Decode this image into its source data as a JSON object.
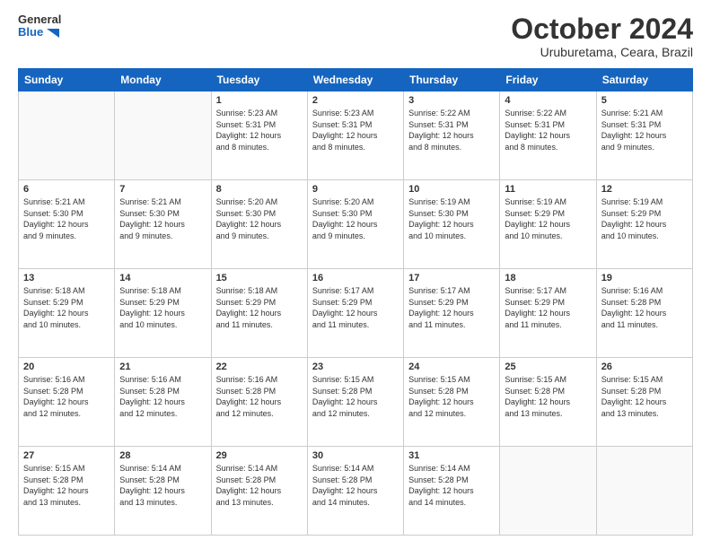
{
  "header": {
    "logo_general": "General",
    "logo_blue": "Blue",
    "month_title": "October 2024",
    "location": "Uruburetama, Ceara, Brazil"
  },
  "calendar": {
    "headers": [
      "Sunday",
      "Monday",
      "Tuesday",
      "Wednesday",
      "Thursday",
      "Friday",
      "Saturday"
    ],
    "weeks": [
      [
        {
          "day": "",
          "info": ""
        },
        {
          "day": "",
          "info": ""
        },
        {
          "day": "1",
          "info": "Sunrise: 5:23 AM\nSunset: 5:31 PM\nDaylight: 12 hours\nand 8 minutes."
        },
        {
          "day": "2",
          "info": "Sunrise: 5:23 AM\nSunset: 5:31 PM\nDaylight: 12 hours\nand 8 minutes."
        },
        {
          "day": "3",
          "info": "Sunrise: 5:22 AM\nSunset: 5:31 PM\nDaylight: 12 hours\nand 8 minutes."
        },
        {
          "day": "4",
          "info": "Sunrise: 5:22 AM\nSunset: 5:31 PM\nDaylight: 12 hours\nand 8 minutes."
        },
        {
          "day": "5",
          "info": "Sunrise: 5:21 AM\nSunset: 5:31 PM\nDaylight: 12 hours\nand 9 minutes."
        }
      ],
      [
        {
          "day": "6",
          "info": "Sunrise: 5:21 AM\nSunset: 5:30 PM\nDaylight: 12 hours\nand 9 minutes."
        },
        {
          "day": "7",
          "info": "Sunrise: 5:21 AM\nSunset: 5:30 PM\nDaylight: 12 hours\nand 9 minutes."
        },
        {
          "day": "8",
          "info": "Sunrise: 5:20 AM\nSunset: 5:30 PM\nDaylight: 12 hours\nand 9 minutes."
        },
        {
          "day": "9",
          "info": "Sunrise: 5:20 AM\nSunset: 5:30 PM\nDaylight: 12 hours\nand 9 minutes."
        },
        {
          "day": "10",
          "info": "Sunrise: 5:19 AM\nSunset: 5:30 PM\nDaylight: 12 hours\nand 10 minutes."
        },
        {
          "day": "11",
          "info": "Sunrise: 5:19 AM\nSunset: 5:29 PM\nDaylight: 12 hours\nand 10 minutes."
        },
        {
          "day": "12",
          "info": "Sunrise: 5:19 AM\nSunset: 5:29 PM\nDaylight: 12 hours\nand 10 minutes."
        }
      ],
      [
        {
          "day": "13",
          "info": "Sunrise: 5:18 AM\nSunset: 5:29 PM\nDaylight: 12 hours\nand 10 minutes."
        },
        {
          "day": "14",
          "info": "Sunrise: 5:18 AM\nSunset: 5:29 PM\nDaylight: 12 hours\nand 10 minutes."
        },
        {
          "day": "15",
          "info": "Sunrise: 5:18 AM\nSunset: 5:29 PM\nDaylight: 12 hours\nand 11 minutes."
        },
        {
          "day": "16",
          "info": "Sunrise: 5:17 AM\nSunset: 5:29 PM\nDaylight: 12 hours\nand 11 minutes."
        },
        {
          "day": "17",
          "info": "Sunrise: 5:17 AM\nSunset: 5:29 PM\nDaylight: 12 hours\nand 11 minutes."
        },
        {
          "day": "18",
          "info": "Sunrise: 5:17 AM\nSunset: 5:29 PM\nDaylight: 12 hours\nand 11 minutes."
        },
        {
          "day": "19",
          "info": "Sunrise: 5:16 AM\nSunset: 5:28 PM\nDaylight: 12 hours\nand 11 minutes."
        }
      ],
      [
        {
          "day": "20",
          "info": "Sunrise: 5:16 AM\nSunset: 5:28 PM\nDaylight: 12 hours\nand 12 minutes."
        },
        {
          "day": "21",
          "info": "Sunrise: 5:16 AM\nSunset: 5:28 PM\nDaylight: 12 hours\nand 12 minutes."
        },
        {
          "day": "22",
          "info": "Sunrise: 5:16 AM\nSunset: 5:28 PM\nDaylight: 12 hours\nand 12 minutes."
        },
        {
          "day": "23",
          "info": "Sunrise: 5:15 AM\nSunset: 5:28 PM\nDaylight: 12 hours\nand 12 minutes."
        },
        {
          "day": "24",
          "info": "Sunrise: 5:15 AM\nSunset: 5:28 PM\nDaylight: 12 hours\nand 12 minutes."
        },
        {
          "day": "25",
          "info": "Sunrise: 5:15 AM\nSunset: 5:28 PM\nDaylight: 12 hours\nand 13 minutes."
        },
        {
          "day": "26",
          "info": "Sunrise: 5:15 AM\nSunset: 5:28 PM\nDaylight: 12 hours\nand 13 minutes."
        }
      ],
      [
        {
          "day": "27",
          "info": "Sunrise: 5:15 AM\nSunset: 5:28 PM\nDaylight: 12 hours\nand 13 minutes."
        },
        {
          "day": "28",
          "info": "Sunrise: 5:14 AM\nSunset: 5:28 PM\nDaylight: 12 hours\nand 13 minutes."
        },
        {
          "day": "29",
          "info": "Sunrise: 5:14 AM\nSunset: 5:28 PM\nDaylight: 12 hours\nand 13 minutes."
        },
        {
          "day": "30",
          "info": "Sunrise: 5:14 AM\nSunset: 5:28 PM\nDaylight: 12 hours\nand 14 minutes."
        },
        {
          "day": "31",
          "info": "Sunrise: 5:14 AM\nSunset: 5:28 PM\nDaylight: 12 hours\nand 14 minutes."
        },
        {
          "day": "",
          "info": ""
        },
        {
          "day": "",
          "info": ""
        }
      ]
    ]
  }
}
